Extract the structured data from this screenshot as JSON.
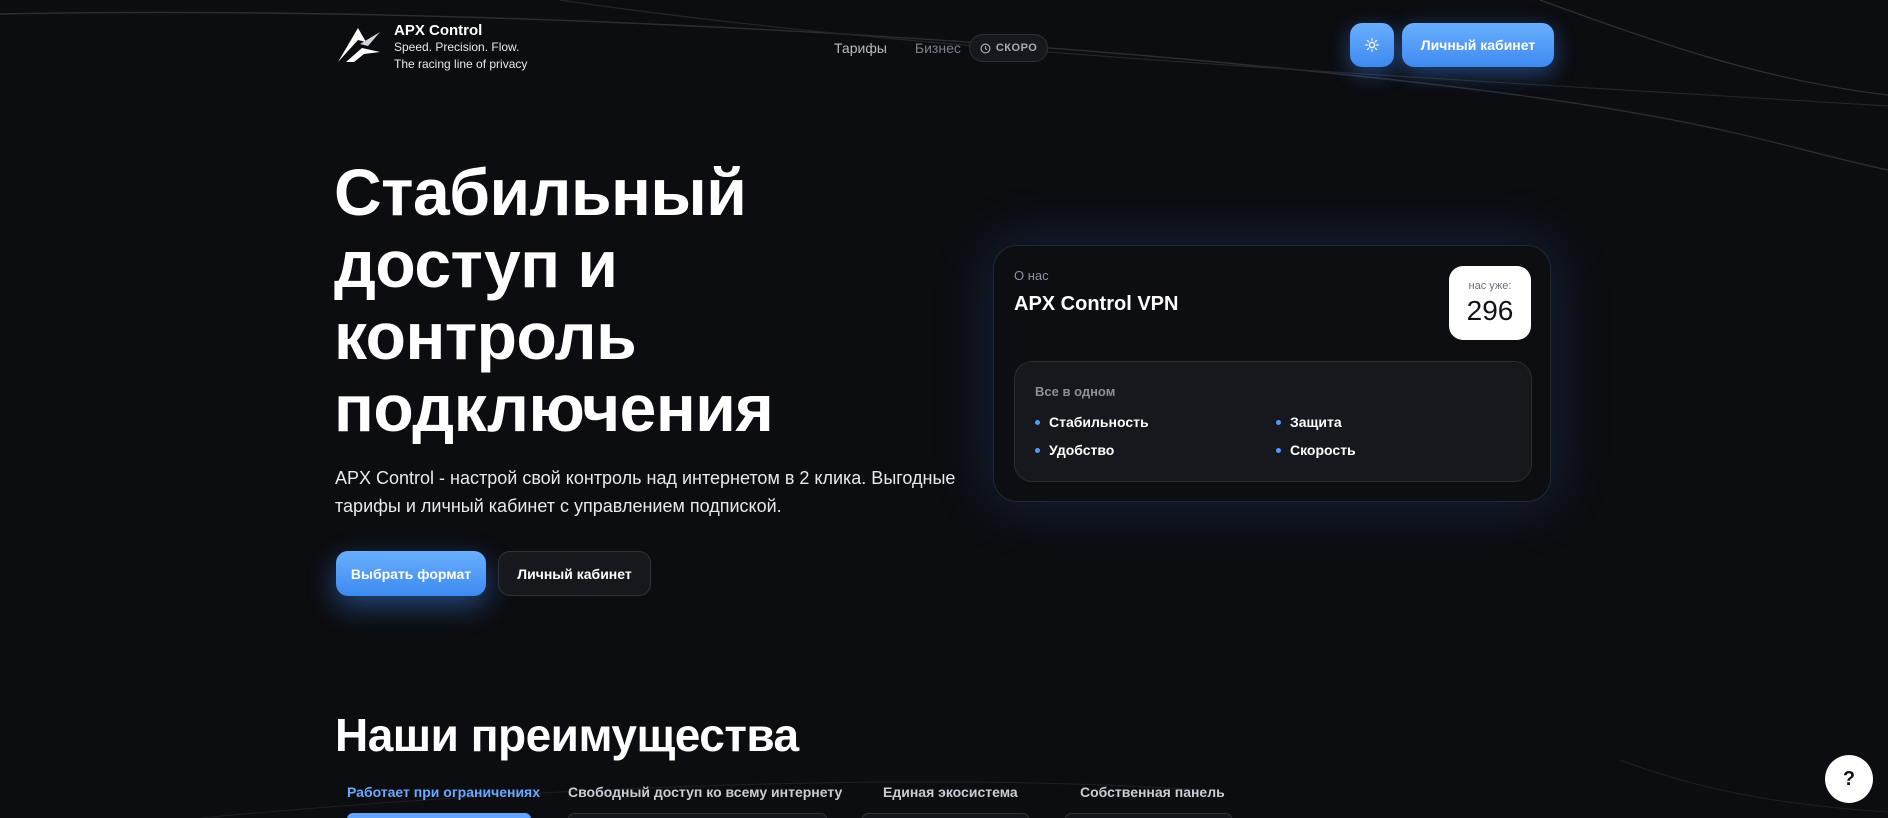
{
  "brand": {
    "name": "APX Control",
    "tagline_1": "Speed. Precision. Flow.",
    "tagline_2": "The racing line of privacy"
  },
  "nav": {
    "tariffs": "Тарифы",
    "business": "Бизнес",
    "soon_badge": "СКОРО"
  },
  "header": {
    "theme_icon": "sun-icon",
    "cabinet_label": "Личный кабинет"
  },
  "hero": {
    "title_line_1": "Стабильный",
    "title_line_2": "доступ и",
    "title_line_3": "контроль",
    "title_line_4": "подключения",
    "desc_line_1": "APX Control - настрой свой контроль над интернетом в 2 клика. Выгодные",
    "desc_line_2": "тарифы и личный кабинет с управлением подпиской.",
    "primary_button": "Выбрать формат",
    "secondary_button": "Личный кабинет"
  },
  "about": {
    "label": "О нас",
    "title": "APX Control VPN",
    "counter_label": "нас уже:",
    "counter_value": "296",
    "panel_title": "Все в одном",
    "features": [
      "Стабильность",
      "Защита",
      "Удобство",
      "Скорость"
    ]
  },
  "advantages": {
    "title": "Наши преимущества",
    "tabs": [
      "Работает при ограничениях",
      "Свободный доступ ко всему интернету",
      "Единая экосистема",
      "Собственная панель"
    ]
  },
  "help": {
    "label": "?"
  },
  "colors": {
    "background": "#0c0d11",
    "accent": "#4f9bff",
    "accent_active_text": "#6aa9ff"
  }
}
